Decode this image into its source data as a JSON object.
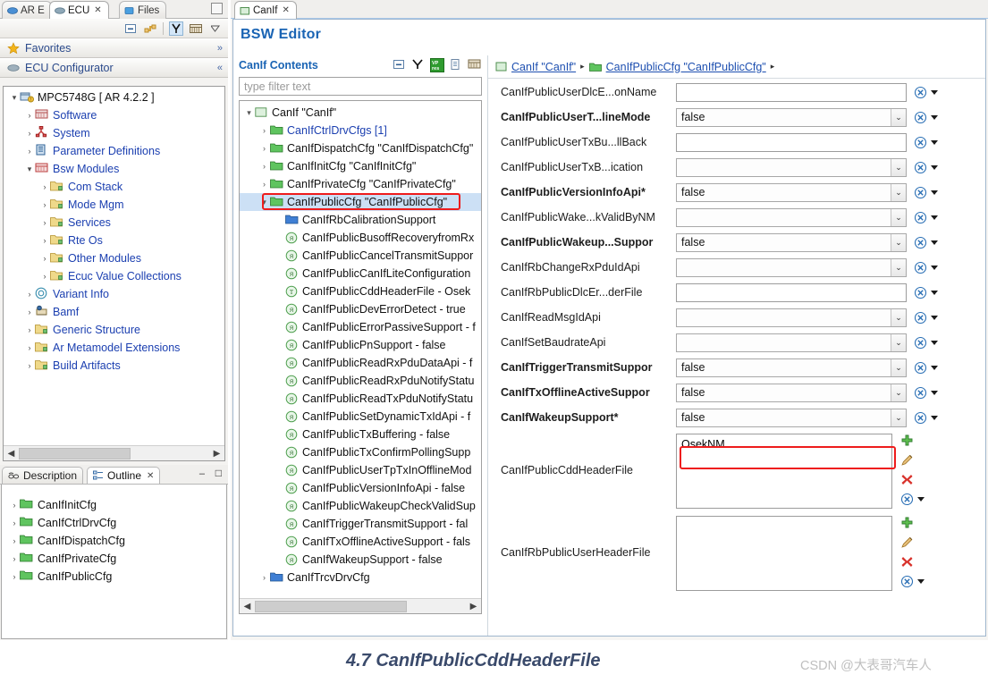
{
  "left_panel": {
    "tabs": [
      {
        "label": "AR E",
        "icon": "perspective-icon",
        "active": false,
        "closeable": false
      },
      {
        "label": "ECU",
        "icon": "ecu-icon",
        "active": true,
        "closeable": true
      },
      {
        "label": "Files",
        "icon": "files-icon",
        "active": false,
        "closeable": false
      }
    ],
    "toolbar_icons": [
      "collapse-all-icon",
      "link-editor-icon",
      "separator",
      "filter-icon",
      "layout-icon",
      "view-menu-icon"
    ],
    "sections": [
      {
        "label": "Favorites",
        "icon": "star-icon",
        "chevron": "»"
      },
      {
        "label": "ECU Configurator",
        "icon": "ecu-icon",
        "chevron": "«"
      }
    ],
    "tree": [
      {
        "depth": 0,
        "arrow": "∨",
        "icon": "ecu-project-icon",
        "label": "MPC5748G [ AR 4.2.2 ]",
        "color": "#111111"
      },
      {
        "depth": 1,
        "arrow": "›",
        "icon": "software-icon",
        "label": "Software",
        "color": "#1b3fb0"
      },
      {
        "depth": 1,
        "arrow": "›",
        "icon": "system-icon",
        "label": "System",
        "color": "#1b3fb0"
      },
      {
        "depth": 1,
        "arrow": "›",
        "icon": "parameter-definitions-icon",
        "label": "Parameter Definitions",
        "color": "#1b3fb0"
      },
      {
        "depth": 1,
        "arrow": "∨",
        "icon": "bsw-modules-icon",
        "label": "Bsw Modules",
        "color": "#1b3fb0"
      },
      {
        "depth": 2,
        "arrow": "›",
        "icon": "folder-icon",
        "label": "Com Stack",
        "color": "#1b3fb0"
      },
      {
        "depth": 2,
        "arrow": "›",
        "icon": "folder-icon",
        "label": "Mode Mgm",
        "color": "#1b3fb0"
      },
      {
        "depth": 2,
        "arrow": "›",
        "icon": "folder-icon",
        "label": "Services",
        "color": "#1b3fb0"
      },
      {
        "depth": 2,
        "arrow": "›",
        "icon": "folder-icon",
        "label": "Rte Os",
        "color": "#1b3fb0"
      },
      {
        "depth": 2,
        "arrow": "›",
        "icon": "folder-icon",
        "label": "Other Modules",
        "color": "#1b3fb0"
      },
      {
        "depth": 2,
        "arrow": "›",
        "icon": "folder-icon",
        "label": "Ecuc Value Collections",
        "color": "#1b3fb0"
      },
      {
        "depth": 1,
        "arrow": "›",
        "icon": "variant-info-icon",
        "label": "Variant Info",
        "color": "#1b3fb0"
      },
      {
        "depth": 1,
        "arrow": "›",
        "icon": "bamf-icon",
        "label": "Bamf",
        "color": "#1b3fb0"
      },
      {
        "depth": 1,
        "arrow": "›",
        "icon": "folder-icon",
        "label": "Generic Structure",
        "color": "#1b3fb0"
      },
      {
        "depth": 1,
        "arrow": "›",
        "icon": "folder-icon",
        "label": "Ar Metamodel Extensions",
        "color": "#1b3fb0"
      },
      {
        "depth": 1,
        "arrow": "›",
        "icon": "folder-icon",
        "label": "Build Artifacts",
        "color": "#1b3fb0"
      }
    ],
    "outline": {
      "tabs": [
        {
          "label": "Description",
          "icon": "description-icon",
          "active": false,
          "closeable": false
        },
        {
          "label": "Outline",
          "icon": "outline-icon",
          "active": true,
          "closeable": true
        }
      ],
      "minimize_glyph": "–",
      "maximize_glyph": "□",
      "items": [
        {
          "arrow": "›",
          "icon": "folder-icon",
          "label": "CanIfInitCfg"
        },
        {
          "arrow": "›",
          "icon": "folder-icon",
          "label": "CanIfCtrlDrvCfg"
        },
        {
          "arrow": "›",
          "icon": "folder-icon",
          "label": "CanIfDispatchCfg"
        },
        {
          "arrow": "›",
          "icon": "folder-icon",
          "label": "CanIfPrivateCfg"
        },
        {
          "arrow": "›",
          "icon": "folder-icon",
          "label": "CanIfPublicCfg"
        }
      ]
    }
  },
  "editor": {
    "tab": {
      "label": "CanIf",
      "icon": "editor-file-icon",
      "close_glyph": "✕"
    },
    "title": "BSW Editor",
    "contents_pane": {
      "header": "CanIf Contents",
      "toolbar_icons": [
        "collapse-all-icon",
        "link-icon",
        "vp-res-icon",
        "document-icon",
        "table-icon"
      ],
      "filter_placeholder": "type filter text",
      "tree": [
        {
          "depth": 0,
          "arrow": "∨",
          "icon": "module-icon",
          "label": "CanIf \"CanIf\"",
          "color": "#111111",
          "highlight": false
        },
        {
          "depth": 1,
          "arrow": "›",
          "icon": "folder-green-icon",
          "label": "CanIfCtrlDrvCfgs [1]",
          "color": "#1b3fb0",
          "highlight": false
        },
        {
          "depth": 1,
          "arrow": "›",
          "icon": "folder-green-icon",
          "label": "CanIfDispatchCfg \"CanIfDispatchCfg\"",
          "color": "#111111",
          "highlight": false
        },
        {
          "depth": 1,
          "arrow": "›",
          "icon": "folder-green-icon",
          "label": "CanIfInitCfg \"CanIfInitCfg\"",
          "color": "#111111",
          "highlight": false
        },
        {
          "depth": 1,
          "arrow": "›",
          "icon": "folder-green-icon",
          "label": "CanIfPrivateCfg \"CanIfPrivateCfg\"",
          "color": "#111111",
          "highlight": false
        },
        {
          "depth": 1,
          "arrow": "∨",
          "icon": "folder-green-icon",
          "label": "CanIfPublicCfg \"CanIfPublicCfg\"",
          "color": "#111111",
          "highlight": true
        },
        {
          "depth": 2,
          "arrow": "",
          "icon": "folder-blue-icon",
          "label": "CanIfRbCalibrationSupport",
          "color": "#111111",
          "highlight": false
        },
        {
          "depth": 2,
          "arrow": "",
          "icon": "param-bool-icon",
          "label": "CanIfPublicBusoffRecoveryfromRx",
          "color": "#111111",
          "highlight": false
        },
        {
          "depth": 2,
          "arrow": "",
          "icon": "param-bool-icon",
          "label": "CanIfPublicCancelTransmitSuppor",
          "color": "#111111",
          "highlight": false
        },
        {
          "depth": 2,
          "arrow": "",
          "icon": "param-bool-icon",
          "label": "CanIfPublicCanIfLiteConfiguration",
          "color": "#111111",
          "highlight": false
        },
        {
          "depth": 2,
          "arrow": "",
          "icon": "param-text-icon",
          "label": "CanIfPublicCddHeaderFile - Osek",
          "color": "#111111",
          "highlight": false
        },
        {
          "depth": 2,
          "arrow": "",
          "icon": "param-bool-icon",
          "label": "CanIfPublicDevErrorDetect - true",
          "color": "#111111",
          "highlight": false
        },
        {
          "depth": 2,
          "arrow": "",
          "icon": "param-bool-icon",
          "label": "CanIfPublicErrorPassiveSupport - f",
          "color": "#111111",
          "highlight": false
        },
        {
          "depth": 2,
          "arrow": "",
          "icon": "param-bool-icon",
          "label": "CanIfPublicPnSupport - false",
          "color": "#111111",
          "highlight": false
        },
        {
          "depth": 2,
          "arrow": "",
          "icon": "param-bool-icon",
          "label": "CanIfPublicReadRxPduDataApi - f",
          "color": "#111111",
          "highlight": false
        },
        {
          "depth": 2,
          "arrow": "",
          "icon": "param-bool-icon",
          "label": "CanIfPublicReadRxPduNotifyStatu",
          "color": "#111111",
          "highlight": false
        },
        {
          "depth": 2,
          "arrow": "",
          "icon": "param-bool-icon",
          "label": "CanIfPublicReadTxPduNotifyStatu",
          "color": "#111111",
          "highlight": false
        },
        {
          "depth": 2,
          "arrow": "",
          "icon": "param-bool-icon",
          "label": "CanIfPublicSetDynamicTxIdApi - f",
          "color": "#111111",
          "highlight": false
        },
        {
          "depth": 2,
          "arrow": "",
          "icon": "param-bool-icon",
          "label": "CanIfPublicTxBuffering - false",
          "color": "#111111",
          "highlight": false
        },
        {
          "depth": 2,
          "arrow": "",
          "icon": "param-bool-icon",
          "label": "CanIfPublicTxConfirmPollingSupp",
          "color": "#111111",
          "highlight": false
        },
        {
          "depth": 2,
          "arrow": "",
          "icon": "param-bool-icon",
          "label": "CanIfPublicUserTpTxInOfflineMod",
          "color": "#111111",
          "highlight": false
        },
        {
          "depth": 2,
          "arrow": "",
          "icon": "param-bool-icon",
          "label": "CanIfPublicVersionInfoApi - false",
          "color": "#111111",
          "highlight": false
        },
        {
          "depth": 2,
          "arrow": "",
          "icon": "param-bool-icon",
          "label": "CanIfPublicWakeupCheckValidSup",
          "color": "#111111",
          "highlight": false
        },
        {
          "depth": 2,
          "arrow": "",
          "icon": "param-bool-icon",
          "label": "CanIfTriggerTransmitSupport - fal",
          "color": "#111111",
          "highlight": false
        },
        {
          "depth": 2,
          "arrow": "",
          "icon": "param-bool-icon",
          "label": "CanIfTxOfflineActiveSupport - fals",
          "color": "#111111",
          "highlight": false
        },
        {
          "depth": 2,
          "arrow": "",
          "icon": "param-bool-icon",
          "label": "CanIfWakeupSupport - false",
          "color": "#111111",
          "highlight": false
        },
        {
          "depth": 1,
          "arrow": "›",
          "icon": "folder-blue-icon",
          "label": "CanIfTrcvDrvCfg",
          "color": "#111111",
          "highlight": false
        }
      ]
    },
    "breadcrumb": [
      {
        "icon": "module-icon",
        "label": "CanIf \"CanIf\""
      },
      {
        "icon": "folder-green-icon",
        "label": "CanIfPublicCfg \"CanIfPublicCfg\""
      }
    ],
    "breadcrumb_separator": "▸",
    "fields": [
      {
        "label": "CanIfPublicUserDlcE...onName",
        "bold": false,
        "type": "text",
        "value": ""
      },
      {
        "label": "CanIfPublicUserT...lineMode",
        "bold": true,
        "type": "combo",
        "value": "false"
      },
      {
        "label": "CanIfPublicUserTxBu...llBack",
        "bold": false,
        "type": "text",
        "value": ""
      },
      {
        "label": "CanIfPublicUserTxB...ication",
        "bold": false,
        "type": "combo",
        "value": ""
      },
      {
        "label": "CanIfPublicVersionInfoApi*",
        "bold": true,
        "type": "combo",
        "value": "false"
      },
      {
        "label": "CanIfPublicWake...kValidByNM",
        "bold": false,
        "type": "combo",
        "value": ""
      },
      {
        "label": "CanIfPublicWakeup...Suppor",
        "bold": true,
        "type": "combo",
        "value": "false"
      },
      {
        "label": "CanIfRbChangeRxPduIdApi",
        "bold": false,
        "type": "combo",
        "value": ""
      },
      {
        "label": "CanIfRbPublicDlcEr...derFile",
        "bold": false,
        "type": "text",
        "value": ""
      },
      {
        "label": "CanIfReadMsgIdApi",
        "bold": false,
        "type": "combo",
        "value": ""
      },
      {
        "label": "CanIfSetBaudrateApi",
        "bold": false,
        "type": "combo",
        "value": ""
      },
      {
        "label": "CanIfTriggerTransmitSuppor",
        "bold": true,
        "type": "combo",
        "value": "false"
      },
      {
        "label": "CanIfTxOfflineActiveSuppor",
        "bold": true,
        "type": "combo",
        "value": "false"
      },
      {
        "label": "CanIfWakeupSupport*",
        "bold": true,
        "type": "combo",
        "value": "false"
      }
    ],
    "list_fields": [
      {
        "label": "CanIfPublicCddHeaderFile",
        "items": [
          "OsekNM"
        ],
        "highlight_first": true,
        "tools": [
          "add-icon",
          "edit-icon",
          "delete-icon",
          "reset-icon",
          "menu-caret"
        ]
      },
      {
        "label": "CanIfRbPublicUserHeaderFile",
        "items": [],
        "highlight_first": false,
        "tools": [
          "add-icon",
          "edit-icon",
          "delete-icon",
          "reset-icon",
          "menu-caret"
        ]
      }
    ]
  },
  "caption": {
    "title": "4.7 CanIfPublicCddHeaderFile",
    "watermark": "CSDN @大表哥汽车人"
  },
  "colors": {
    "accent_blue": "#1a64b4",
    "link_blue": "#1b3fb0",
    "highlight_red": "#ee1c1c",
    "selection_blue": "#cce0f5",
    "folder_green": "#49b849",
    "folder_blue": "#3f7fd4"
  }
}
